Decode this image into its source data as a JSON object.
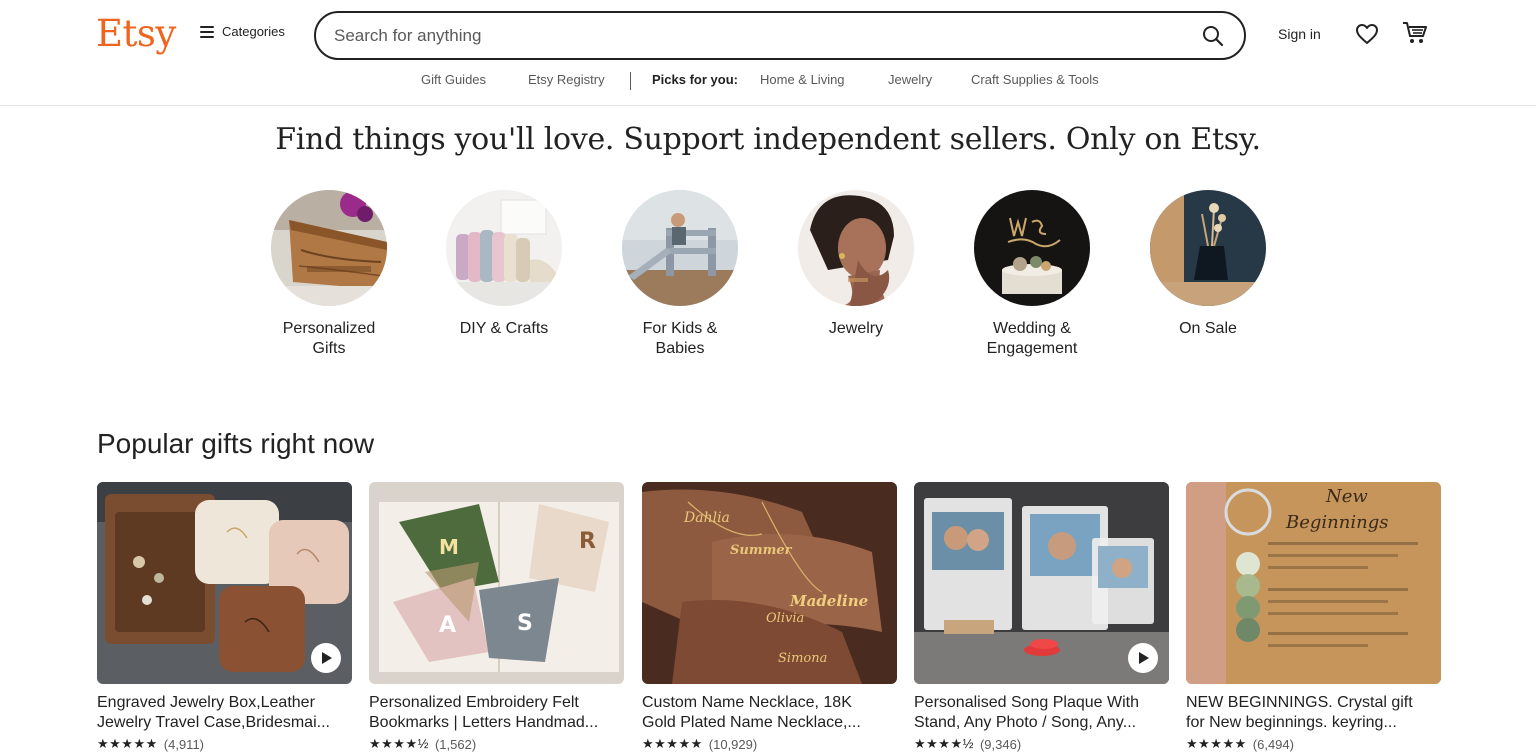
{
  "header": {
    "logo": "Etsy",
    "categories_label": "Categories",
    "search_placeholder": "Search for anything",
    "sign_in": "Sign in"
  },
  "subnav": {
    "gift_guides": "Gift Guides",
    "registry": "Etsy Registry",
    "picks_label": "Picks for you:",
    "home_living": "Home & Living",
    "jewelry": "Jewelry",
    "craft": "Craft Supplies & Tools"
  },
  "hero": {
    "title": "Find things you'll love. Support independent sellers. Only on Etsy.",
    "categories": [
      {
        "line1": "Personalized",
        "line2": "Gifts"
      },
      {
        "line1": "DIY & Crafts",
        "line2": ""
      },
      {
        "line1": "For Kids &",
        "line2": "Babies"
      },
      {
        "line1": "Jewelry",
        "line2": ""
      },
      {
        "line1": "Wedding &",
        "line2": "Engagement"
      },
      {
        "line1": "On Sale",
        "line2": ""
      }
    ]
  },
  "popular": {
    "title": "Popular gifts right now",
    "items": [
      {
        "line1": "Engraved Jewelry Box,Leather",
        "line2": "Jewelry Travel Case,Bridesmai...",
        "stars": "★★★★★",
        "count": "(4,911)",
        "has_video": true
      },
      {
        "line1": "Personalized Embroidery Felt",
        "line2": "Bookmarks | Letters Handmad...",
        "stars": "★★★★½",
        "count": "(1,562)",
        "has_video": false
      },
      {
        "line1": "Custom Name Necklace, 18K",
        "line2": "Gold Plated Name Necklace,...",
        "stars": "★★★★★",
        "count": "(10,929)",
        "has_video": false
      },
      {
        "line1": "Personalised Song Plaque With",
        "line2": "Stand, Any Photo / Song, Any...",
        "stars": "★★★★½",
        "count": "(9,346)",
        "has_video": true
      },
      {
        "line1": "NEW BEGINNINGS. Crystal gift",
        "line2": "for New beginnings. keyring...",
        "stars": "★★★★★",
        "count": "(6,494)",
        "has_video": false
      }
    ]
  },
  "image_text": {
    "card5_heading1": "New",
    "card5_heading2": "Beginnings",
    "necklace1": "Dahlia",
    "necklace2": "Summer",
    "necklace3": "Madeline",
    "necklace4": "Olivia",
    "necklace5": "Simona"
  },
  "colors": {
    "brand": "#f1641e",
    "text": "#222222",
    "muted": "#595959"
  }
}
